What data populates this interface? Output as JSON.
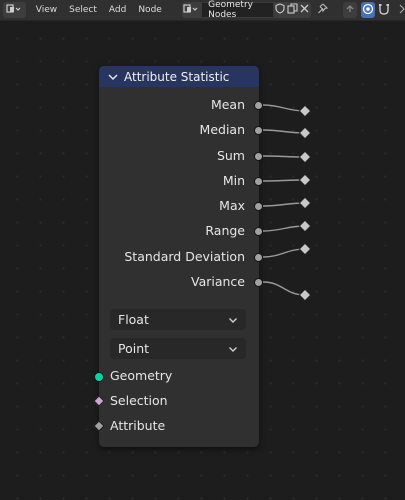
{
  "header": {
    "menus": [
      "View",
      "Select",
      "Add",
      "Node"
    ],
    "node_tree_name": "Geometry Nodes",
    "icons": [
      "editor-type-icon",
      "node-tree-type-icon",
      "fake-user-shield-icon",
      "duplicate-icon",
      "close-icon",
      "pin-icon",
      "parent-up-icon",
      "view-icon",
      "snap-icon"
    ]
  },
  "node": {
    "title": "Attribute Statistic",
    "outputs": [
      "Mean",
      "Median",
      "Sum",
      "Min",
      "Max",
      "Range",
      "Standard Deviation",
      "Variance"
    ],
    "data_type": "Float",
    "domain": "Point",
    "inputs": [
      "Geometry",
      "Selection",
      "Attribute"
    ],
    "colors": {
      "header": "#273560",
      "float_socket": "#a1a1a1",
      "geometry_socket": "#00d6a3",
      "boolean_socket": "#cca6d6",
      "reroute": "#c8c8c8"
    }
  }
}
